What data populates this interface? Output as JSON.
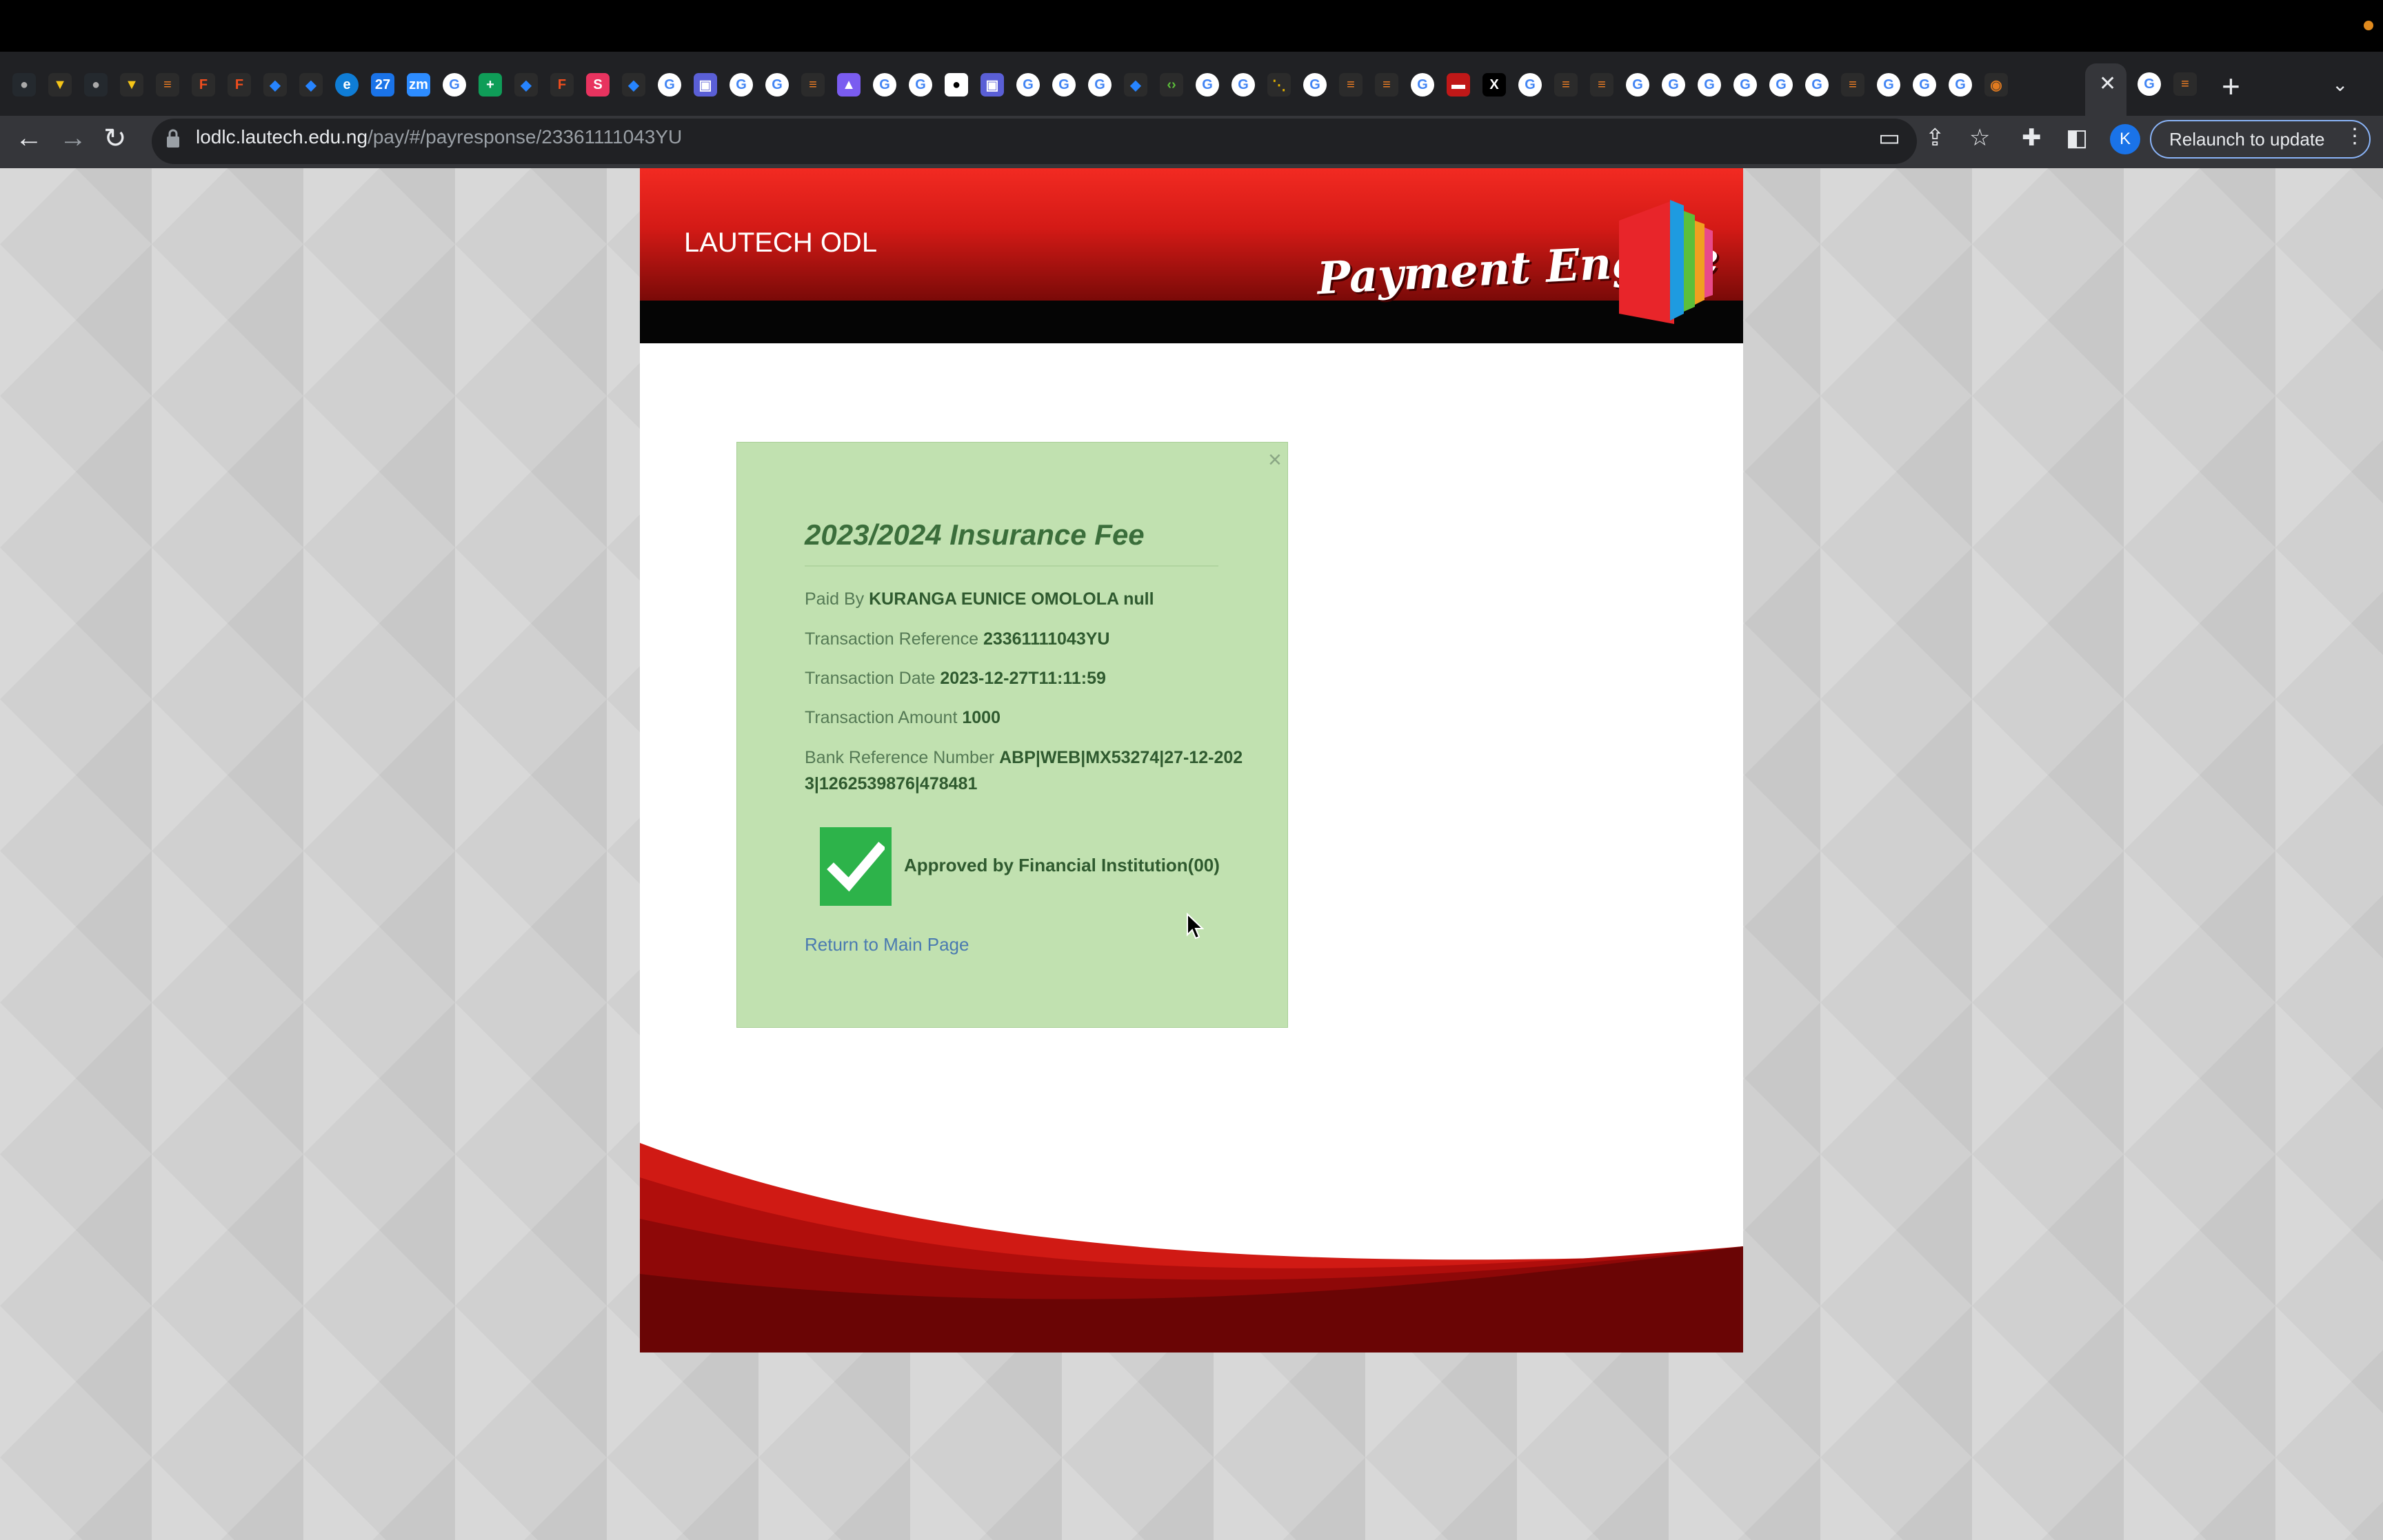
{
  "browser": {
    "address_host": "lodlc.lautech.edu.ng",
    "address_path": "/pay/#/payresponse/23361111043YU",
    "relaunch_label": "Relaunch to update",
    "profile_initial": "K",
    "tab_icons": [
      "github-icon",
      "vercel-icon",
      "github-icon",
      "vercel-icon",
      "stackoverflow-icon",
      "figma-icon",
      "figma-icon",
      "jira-icon",
      "jira-icon",
      "edge-icon",
      "calendar-icon",
      "zoom-icon",
      "google-icon",
      "sheets-icon",
      "jira-icon",
      "figma-icon",
      "s-icon",
      "jira-icon",
      "google-icon",
      "app-icon",
      "google-icon",
      "google-icon",
      "stackoverflow-icon",
      "notion-icon",
      "google-icon",
      "google-icon",
      "circle-icon",
      "app-icon",
      "google-icon",
      "google-icon",
      "google-icon",
      "jira-icon",
      "code-icon",
      "google-icon",
      "google-icon",
      "dots-icon",
      "google-icon",
      "stackoverflow-icon",
      "stackoverflow-icon",
      "google-icon",
      "red-icon",
      "x-icon",
      "google-icon",
      "stackoverflow-icon",
      "stackoverflow-icon",
      "google-icon",
      "google-icon",
      "google-icon",
      "google-icon",
      "google-icon",
      "google-icon",
      "stackoverflow-icon",
      "google-icon",
      "google-icon",
      "google-icon",
      "lautech-icon"
    ],
    "active_tab_close": "✕",
    "trailing_tab_icons": [
      "google-icon",
      "stackoverflow-icon"
    ]
  },
  "site": {
    "title": "LAUTECH ODL",
    "engine_label": "Payment Engine"
  },
  "receipt": {
    "close": "×",
    "title": "2023/2024 Insurance Fee",
    "paid_by_label": "Paid By",
    "paid_by_value": "KURANGA EUNICE OMOLOLA null",
    "ref_label": "Transaction Reference",
    "ref_value": "23361111043YU",
    "date_label": "Transaction Date",
    "date_value": "2023-12-27T11:11:59",
    "amount_label": "Transaction Amount",
    "amount_value": "1000",
    "bank_ref_label": "Bank Reference Number",
    "bank_ref_value": "ABP|WEB|MX53274|27-12-2023|1262539876|478481",
    "status_text": "Approved by Financial Institution(00)",
    "return_link": "Return to Main Page"
  },
  "colors": {
    "header_red": "#d41a16",
    "card_green": "#c1e1b0",
    "approved_green": "#2db34a"
  }
}
